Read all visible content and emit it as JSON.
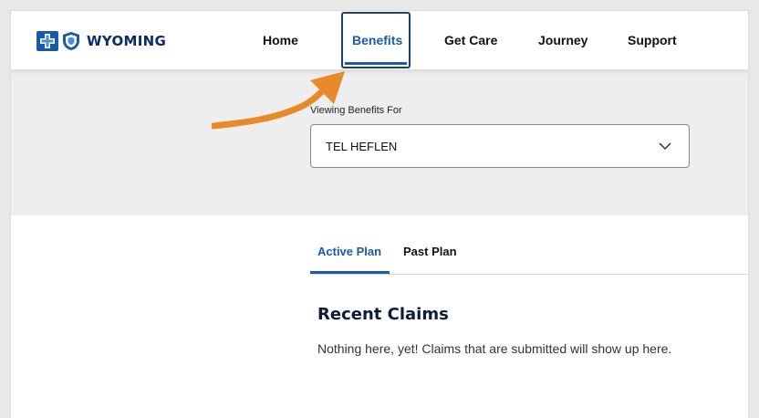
{
  "brand": {
    "name": "WYOMING",
    "icon": "bcbs-logo"
  },
  "nav": {
    "items": [
      {
        "label": "Home"
      },
      {
        "label": "Benefits",
        "active": true
      },
      {
        "label": "Get Care"
      },
      {
        "label": "Journey"
      },
      {
        "label": "Support"
      }
    ]
  },
  "viewing": {
    "label": "Viewing Benefits For",
    "selected": "TEL HEFLEN"
  },
  "tabs": [
    {
      "label": "Active Plan",
      "active": true
    },
    {
      "label": "Past Plan",
      "active": false
    }
  ],
  "claims": {
    "title": "Recent Claims",
    "empty_message": "Nothing here, yet! Claims that are submitted will show up here."
  },
  "colors": {
    "accent": "#1a5ba8",
    "brand_navy": "#0a2c6b",
    "annotation_arrow": "#e8892a",
    "hero_background": "#eeeeee"
  }
}
